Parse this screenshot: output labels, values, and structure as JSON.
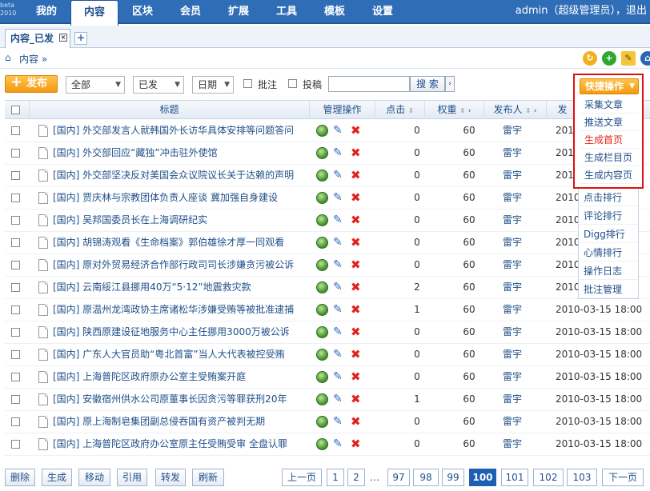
{
  "logo_text": "beta 2010",
  "nav": {
    "items": [
      "我的",
      "内容",
      "区块",
      "会员",
      "扩展",
      "工具",
      "模板",
      "设置"
    ],
    "active_index": 1,
    "user_text": "admin（超级管理员），退出"
  },
  "tab": {
    "label": "内容_已发",
    "close": "×",
    "add": "+"
  },
  "breadcrumb": {
    "text": "内容 »"
  },
  "toolbar": {
    "publish_label": "发布",
    "filter_all": "全部",
    "filter_status": "已发",
    "filter_date": "日期",
    "check_comment": "批注",
    "check_submit": "投稿",
    "search_placeholder": "",
    "search_button": "搜 索"
  },
  "table": {
    "headers": {
      "title": "标题",
      "ops": "管理操作",
      "clicks": "点击",
      "weight": "权重",
      "author": "发布人",
      "date": "发"
    },
    "rows": [
      {
        "title": "[国内] 外交部发言人就韩国外长访华具体安排等问题答问",
        "clicks": "0",
        "weight": "60",
        "author": "雷宇",
        "date": "2010"
      },
      {
        "title": "[国内] 外交部回应“藏独”冲击驻外使馆",
        "clicks": "0",
        "weight": "60",
        "author": "雷宇",
        "date": "2010"
      },
      {
        "title": "[国内] 外交部坚决反对美国会众议院议长关于达赖的声明",
        "clicks": "0",
        "weight": "60",
        "author": "雷宇",
        "date": "2010"
      },
      {
        "title": "[国内] 贾庆林与宗教团体负责人座谈 冀加强自身建设",
        "clicks": "0",
        "weight": "60",
        "author": "雷宇",
        "date": "2010"
      },
      {
        "title": "[国内] 吴邦国委员长在上海调研纪实",
        "clicks": "0",
        "weight": "60",
        "author": "雷宇",
        "date": "2010"
      },
      {
        "title": "[国内] 胡锦涛观看《生命档案》郭伯雄徐才厚一同观看",
        "clicks": "0",
        "weight": "60",
        "author": "雷宇",
        "date": "2010"
      },
      {
        "title": "[国内] 原对外贸易经济合作部行政司司长涉嫌贪污被公诉",
        "clicks": "0",
        "weight": "60",
        "author": "雷宇",
        "date": "2010"
      },
      {
        "title": "[国内] 云南绥江县挪用40万“5·12”地震救灾款",
        "clicks": "2",
        "weight": "60",
        "author": "雷宇",
        "date": "2010"
      },
      {
        "title": "[国内] 原温州龙湾政协主席诸松华涉嫌受贿等被批准逮捕",
        "clicks": "1",
        "weight": "60",
        "author": "雷宇",
        "date": "2010-03-15 18:00"
      },
      {
        "title": "[国内] 陕西原建设征地服务中心主任挪用3000万被公诉",
        "clicks": "0",
        "weight": "60",
        "author": "雷宇",
        "date": "2010-03-15 18:00"
      },
      {
        "title": "[国内] 广东人大官员助“粤北首富”当人大代表被控受贿",
        "clicks": "0",
        "weight": "60",
        "author": "雷宇",
        "date": "2010-03-15 18:00"
      },
      {
        "title": "[国内] 上海普陀区政府原办公室主受贿案开庭",
        "clicks": "0",
        "weight": "60",
        "author": "雷宇",
        "date": "2010-03-15 18:00"
      },
      {
        "title": "[国内] 安徽宿州供水公司原董事长因贪污等罪获刑20年",
        "clicks": "1",
        "weight": "60",
        "author": "雷宇",
        "date": "2010-03-15 18:00"
      },
      {
        "title": "[国内] 原上海制皂集团副总侵吞国有资产被判无期",
        "clicks": "0",
        "weight": "60",
        "author": "雷宇",
        "date": "2010-03-15 18:00"
      },
      {
        "title": "[国内] 上海普陀区政府办公室原主任受贿受审 全盘认罪",
        "clicks": "0",
        "weight": "60",
        "author": "雷宇",
        "date": "2010-03-15 18:00"
      }
    ]
  },
  "quick_ops": {
    "button": "快捷操作",
    "items": [
      {
        "label": "采集文章",
        "red": false
      },
      {
        "label": "推送文章",
        "red": false
      },
      {
        "label": "生成首页",
        "red": true
      },
      {
        "label": "生成栏目页",
        "red": false
      },
      {
        "label": "生成内容页",
        "red": false
      }
    ],
    "more_items": [
      "点击排行",
      "评论排行",
      "Digg排行",
      "心情排行",
      "操作日志",
      "批注管理"
    ]
  },
  "footer": {
    "actions": [
      "删除",
      "生成",
      "移动",
      "引用",
      "转发",
      "刷新"
    ],
    "pager": {
      "prev": "上一页",
      "next": "下一页",
      "pages": [
        "1",
        "2",
        "…",
        "97",
        "98",
        "99",
        "100",
        "101",
        "102",
        "103"
      ],
      "current": "100"
    }
  }
}
